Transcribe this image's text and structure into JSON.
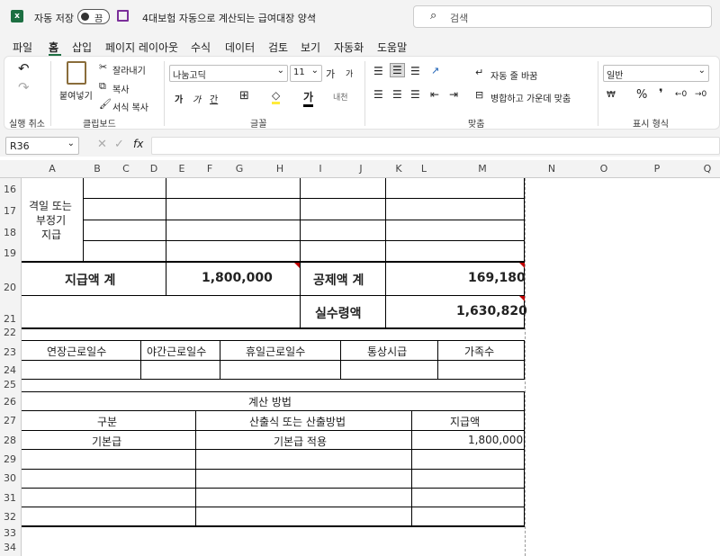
{
  "titlebar": {
    "autosave_label": "자동 저장",
    "toggle_label": "끔",
    "filename": "4대보험 자동으로 계산되는 급여대장 양식",
    "search_placeholder": "검색"
  },
  "menu": [
    "파일",
    "홈",
    "삽입",
    "페이지 레이아웃",
    "수식",
    "데이터",
    "검토",
    "보기",
    "자동화",
    "도움말"
  ],
  "ribbon": {
    "undo_group": "실행 취소",
    "paste": "붙여넣기",
    "cut": "잘라내기",
    "copy": "복사",
    "format_painter": "서식 복사",
    "clipboard_group": "클립보드",
    "font_name": "나눔고딕",
    "font_size": "11",
    "font_group": "글꼴",
    "wrap_text": "자동 줄 바꿈",
    "merge_center": "병합하고 가운데 맞춤",
    "align_group": "맞춤",
    "number_format": "일반",
    "number_group": "표시 형식",
    "bold": "가",
    "italic": "가",
    "underline": "간",
    "grow": "가",
    "shrink": "가"
  },
  "formula": {
    "name_box": "R36",
    "fx": "fx"
  },
  "columns": [
    "A",
    "B",
    "C",
    "D",
    "E",
    "F",
    "G",
    "H",
    "I",
    "J",
    "K",
    "L",
    "M",
    "N",
    "O",
    "P",
    "Q"
  ],
  "rows": [
    "16",
    "17",
    "18",
    "19",
    "20",
    "21",
    "22",
    "23",
    "24",
    "25",
    "26",
    "27",
    "28",
    "29",
    "30",
    "31",
    "32",
    "33",
    "34"
  ],
  "sheet": {
    "irregular_label": "격일 또는\n부정기\n지급",
    "irregular_l1": "격일 또는",
    "irregular_l2": "부정기",
    "irregular_l3": "지급",
    "total_pay_label": "지급액 계",
    "total_pay": "1,800,000",
    "deduction_label": "공제액 계",
    "deduction": "169,180",
    "net_label": "실수령액",
    "net": "1,630,820",
    "headers2": [
      "연장근로일수",
      "야간근로일수",
      "휴일근로일수",
      "통상시급",
      "가족수"
    ],
    "calc_title": "계산 방법",
    "calc_headers": [
      "구분",
      "산출식 또는 산출방법",
      "지급액"
    ],
    "calc_row": [
      "기본급",
      "기본급 적용",
      "1,800,000"
    ]
  }
}
